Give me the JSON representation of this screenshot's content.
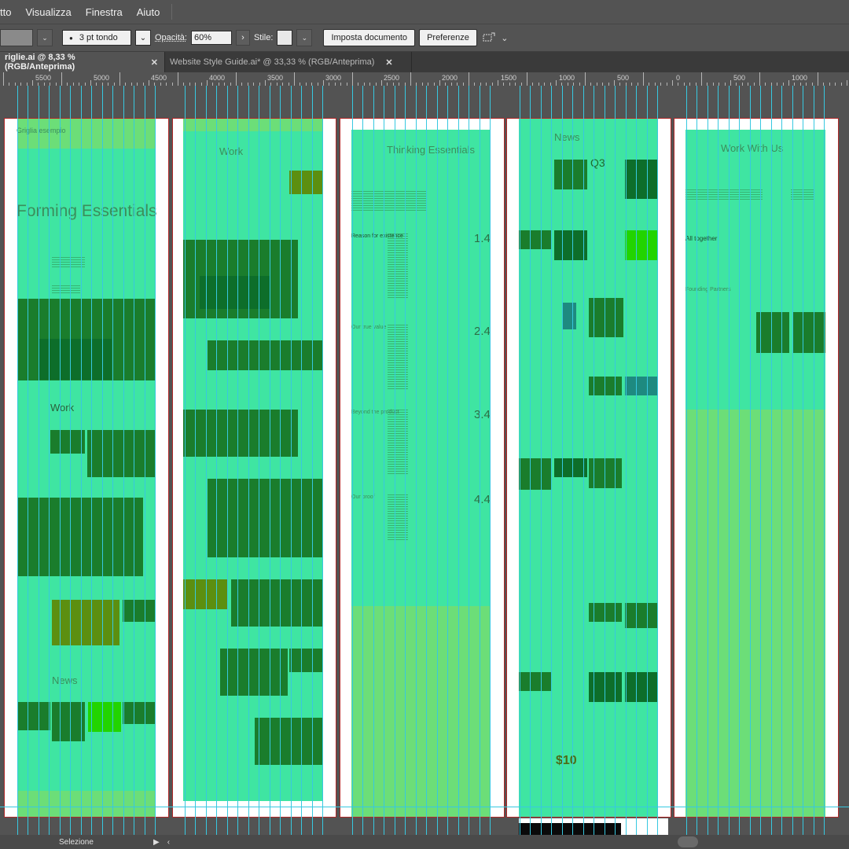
{
  "menubar": {
    "items": [
      "tto",
      "Visualizza",
      "Finestra",
      "Aiuto"
    ]
  },
  "controlbar": {
    "stroke_value": "3 pt tondo",
    "opacity_label": "Opacità:",
    "opacity_value": "60%",
    "style_label": "Stile:",
    "document_setup_label": "Imposta documento",
    "preferences_label": "Preferenze"
  },
  "tabs": [
    {
      "label": "riglie.ai @ 8,33 % (RGB/Anteprima)",
      "close": "✕"
    },
    {
      "label": "Website Style Guide.ai* @ 33,33 % (RGB/Anteprima)",
      "close": "✕"
    }
  ],
  "ruler": {
    "labels": [
      "5500",
      "5000",
      "4500",
      "4000",
      "3500",
      "3000",
      "2500",
      "2000",
      "1500",
      "1000",
      "500",
      "0",
      "500",
      "1000"
    ]
  },
  "artboards": {
    "ab1": {
      "label": "Griglia esempio",
      "heading": "Forming Essentials",
      "section_work": "Work",
      "section_news": "News"
    },
    "ab2": {
      "heading": "Work"
    },
    "ab3": {
      "heading": "Thinking Essentials",
      "items": [
        {
          "label": "Reason for existence",
          "number": "1.4"
        },
        {
          "label": "Our true value",
          "number": "2.4"
        },
        {
          "label": "Beyond the product",
          "number": "3.4"
        },
        {
          "label": "Our proof",
          "number": "4.4"
        }
      ]
    },
    "ab4": {
      "heading": "News",
      "tile_a": "Q3",
      "tile_b": "$10"
    },
    "ab5": {
      "heading": "Work With Us",
      "subhead": "All together",
      "sub2": "Founding Partners"
    }
  },
  "status": {
    "tool": "Selezione"
  },
  "colors": {
    "overlay_green": "#2fe39a",
    "guide_cyan": "#37c8e0",
    "artboard_border": "#b02828"
  }
}
